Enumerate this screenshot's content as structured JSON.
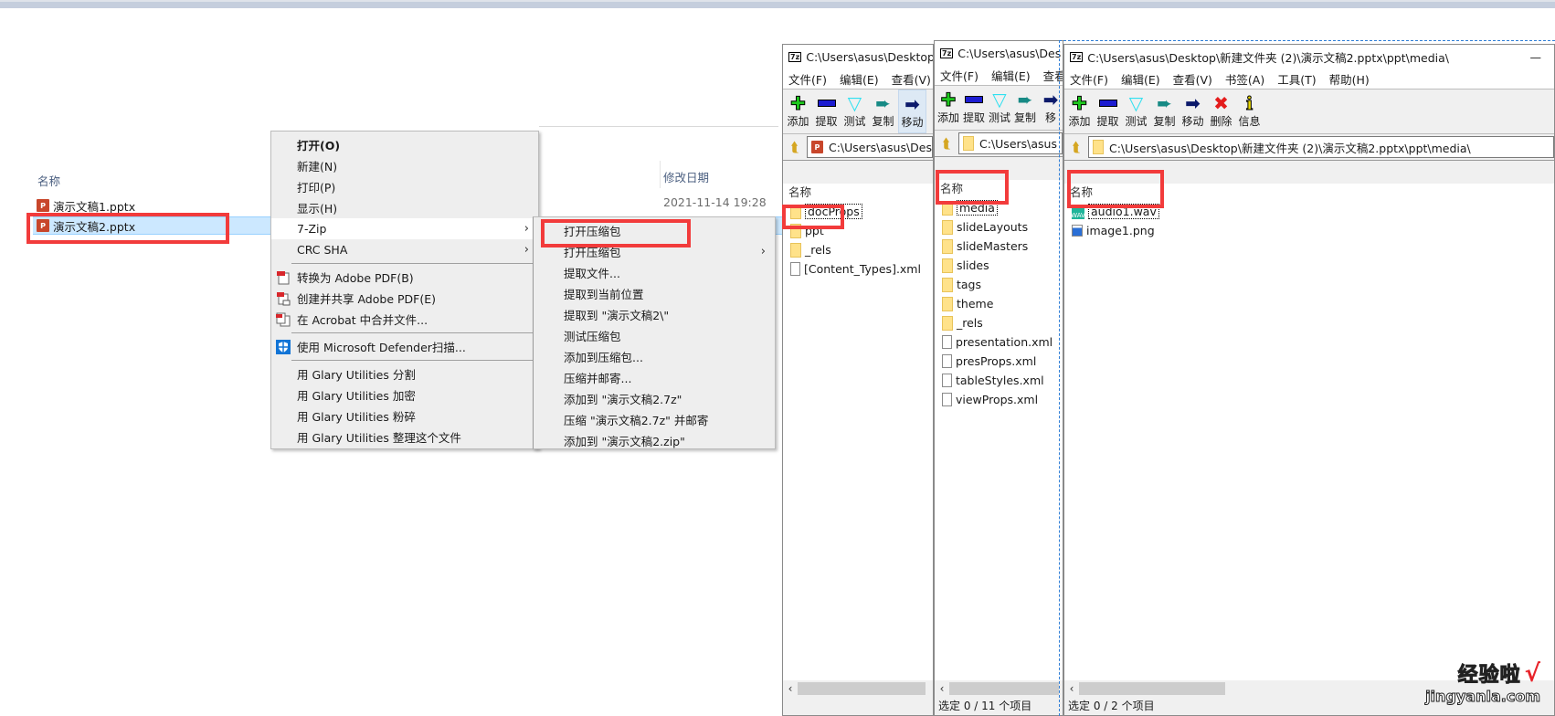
{
  "explorer": {
    "col_name": "名称",
    "col_date": "修改日期",
    "files": [
      {
        "name": "演示文稿1.pptx",
        "icon": "pptx-icon",
        "selected": false
      },
      {
        "name": "演示文稿2.pptx",
        "icon": "pptx-icon",
        "selected": true
      }
    ],
    "date_value": "2021-11-14 19:28"
  },
  "context_menu": {
    "items": [
      {
        "label": "打开(O)",
        "bold": true
      },
      {
        "label": "新建(N)"
      },
      {
        "label": "打印(P)"
      },
      {
        "label": "显示(H)"
      },
      {
        "label": "7-Zip",
        "submenu": true,
        "highlighted": true
      },
      {
        "label": "CRC SHA",
        "submenu": true
      },
      {
        "label": "转换为 Adobe PDF(B)",
        "icon": "adobe-pdf-icon"
      },
      {
        "label": "创建并共享 Adobe PDF(E)",
        "icon": "adobe-share-icon"
      },
      {
        "label": "在 Acrobat 中合并文件...",
        "icon": "acrobat-combine-icon"
      },
      {
        "label": "使用 Microsoft Defender扫描...",
        "icon": "defender-shield-icon"
      },
      {
        "label": "用 Glary Utilities 分割"
      },
      {
        "label": "用 Glary Utilities 加密"
      },
      {
        "label": "用 Glary Utilities 粉碎"
      },
      {
        "label": "用 Glary Utilities 整理这个文件"
      }
    ]
  },
  "zip_submenu": {
    "items": [
      "打开压缩包",
      "打开压缩包",
      "提取文件...",
      "提取到当前位置",
      "提取到 \"演示文稿2\\\"",
      "测试压缩包",
      "添加到压缩包...",
      "压缩并邮寄...",
      "添加到 \"演示文稿2.7z\"",
      "压缩 \"演示文稿2.7z\" 并邮寄",
      "添加到 \"演示文稿2.zip\""
    ]
  },
  "window1": {
    "title": "C:\\Users\\asus\\Desktop",
    "menus": [
      "文件(F)",
      "编辑(E)",
      "查看(V)"
    ],
    "tools": [
      "添加",
      "提取",
      "测试",
      "复制",
      "移动"
    ],
    "address": "C:\\Users\\asus\\Des",
    "list_header": "名称",
    "items": [
      {
        "name": "docProps",
        "type": "folder"
      },
      {
        "name": "ppt",
        "type": "folder"
      },
      {
        "name": "_rels",
        "type": "folder"
      },
      {
        "name": "[Content_Types].xml",
        "type": "file"
      }
    ]
  },
  "window2": {
    "title": "C:\\Users\\asus\\Des",
    "menus": [
      "文件(F)",
      "编辑(E)",
      "查看"
    ],
    "tools": [
      "添加",
      "提取",
      "测试",
      "复制",
      "移"
    ],
    "address": "C:\\Users\\asus",
    "list_header": "名称",
    "items": [
      {
        "name": "media",
        "type": "folder"
      },
      {
        "name": "slideLayouts",
        "type": "folder"
      },
      {
        "name": "slideMasters",
        "type": "folder"
      },
      {
        "name": "slides",
        "type": "folder"
      },
      {
        "name": "tags",
        "type": "folder"
      },
      {
        "name": "theme",
        "type": "folder"
      },
      {
        "name": "_rels",
        "type": "folder"
      },
      {
        "name": "presentation.xml",
        "type": "file"
      },
      {
        "name": "presProps.xml",
        "type": "file"
      },
      {
        "name": "tableStyles.xml",
        "type": "file"
      },
      {
        "name": "viewProps.xml",
        "type": "file"
      }
    ],
    "status": "选定 0 / 11 个项目"
  },
  "window3": {
    "title": "C:\\Users\\asus\\Desktop\\新建文件夹 (2)\\演示文稿2.pptx\\ppt\\media\\",
    "minimize": "—",
    "menus": [
      "文件(F)",
      "编辑(E)",
      "查看(V)",
      "书签(A)",
      "工具(T)",
      "帮助(H)"
    ],
    "tools": [
      "添加",
      "提取",
      "测试",
      "复制",
      "移动",
      "删除",
      "信息"
    ],
    "address": "C:\\Users\\asus\\Desktop\\新建文件夹 (2)\\演示文稿2.pptx\\ppt\\media\\",
    "list_header": "名称",
    "items": [
      {
        "name": "audio1.wav",
        "type": "wav"
      },
      {
        "name": "image1.png",
        "type": "png"
      }
    ],
    "status": "选定 0 / 2 个项目"
  },
  "watermark": {
    "line1": "经验啦",
    "check": "√",
    "line2": "jingyanla.com"
  }
}
